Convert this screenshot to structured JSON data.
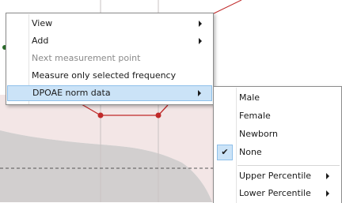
{
  "context_menu": {
    "items": [
      {
        "label": "View",
        "has_submenu": true,
        "enabled": true
      },
      {
        "label": "Add",
        "has_submenu": true,
        "enabled": true
      },
      {
        "label": "Next measurement point",
        "has_submenu": false,
        "enabled": false
      },
      {
        "label": "Measure only selected frequency",
        "has_submenu": false,
        "enabled": true
      },
      {
        "label": "DPOAE norm data",
        "has_submenu": true,
        "enabled": true,
        "highlighted": true
      }
    ]
  },
  "submenu": {
    "items": [
      {
        "label": "Male",
        "checked": false
      },
      {
        "label": "Female",
        "checked": false
      },
      {
        "label": "Newborn",
        "checked": false
      },
      {
        "label": "None",
        "checked": true
      },
      {
        "label": "Upper Percentile",
        "has_submenu": true
      },
      {
        "label": "Lower Percentile",
        "has_submenu": true
      }
    ],
    "check_glyph": "✔"
  },
  "colors": {
    "highlight_bg": "#cbe3f7",
    "highlight_border": "#8fc0ea",
    "data_line": "#c02a2a",
    "norm_area_dark": "#d2cfcf",
    "norm_area_light": "#f3e6e6"
  },
  "icons": [
    "submenu-arrow-icon",
    "checkmark-icon"
  ]
}
